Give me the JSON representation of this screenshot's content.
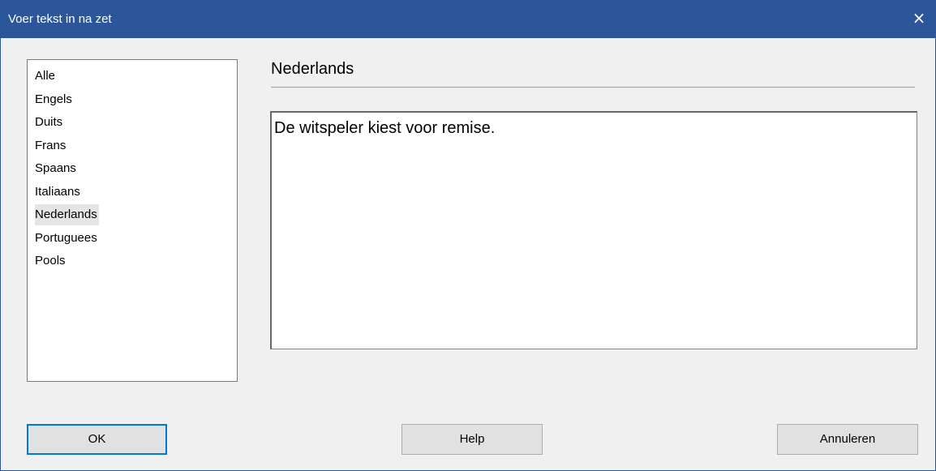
{
  "window": {
    "title": "Voer tekst in na zet",
    "close_symbol": "×"
  },
  "languages": {
    "items": [
      "Alle",
      "Engels",
      "Duits",
      "Frans",
      "Spaans",
      "Italiaans",
      "Nederlands",
      "Portuguees",
      "Pools"
    ],
    "selected": "Nederlands"
  },
  "main": {
    "heading": "Nederlands",
    "text": "De witspeler kiest voor remise."
  },
  "buttons": {
    "ok": "OK",
    "help": "Help",
    "cancel": "Annuleren"
  },
  "colors": {
    "titlebar": "#2b579a",
    "accent": "#0078d7",
    "selection": "#e5e5e5"
  },
  "icons": {
    "close": "close-icon"
  }
}
